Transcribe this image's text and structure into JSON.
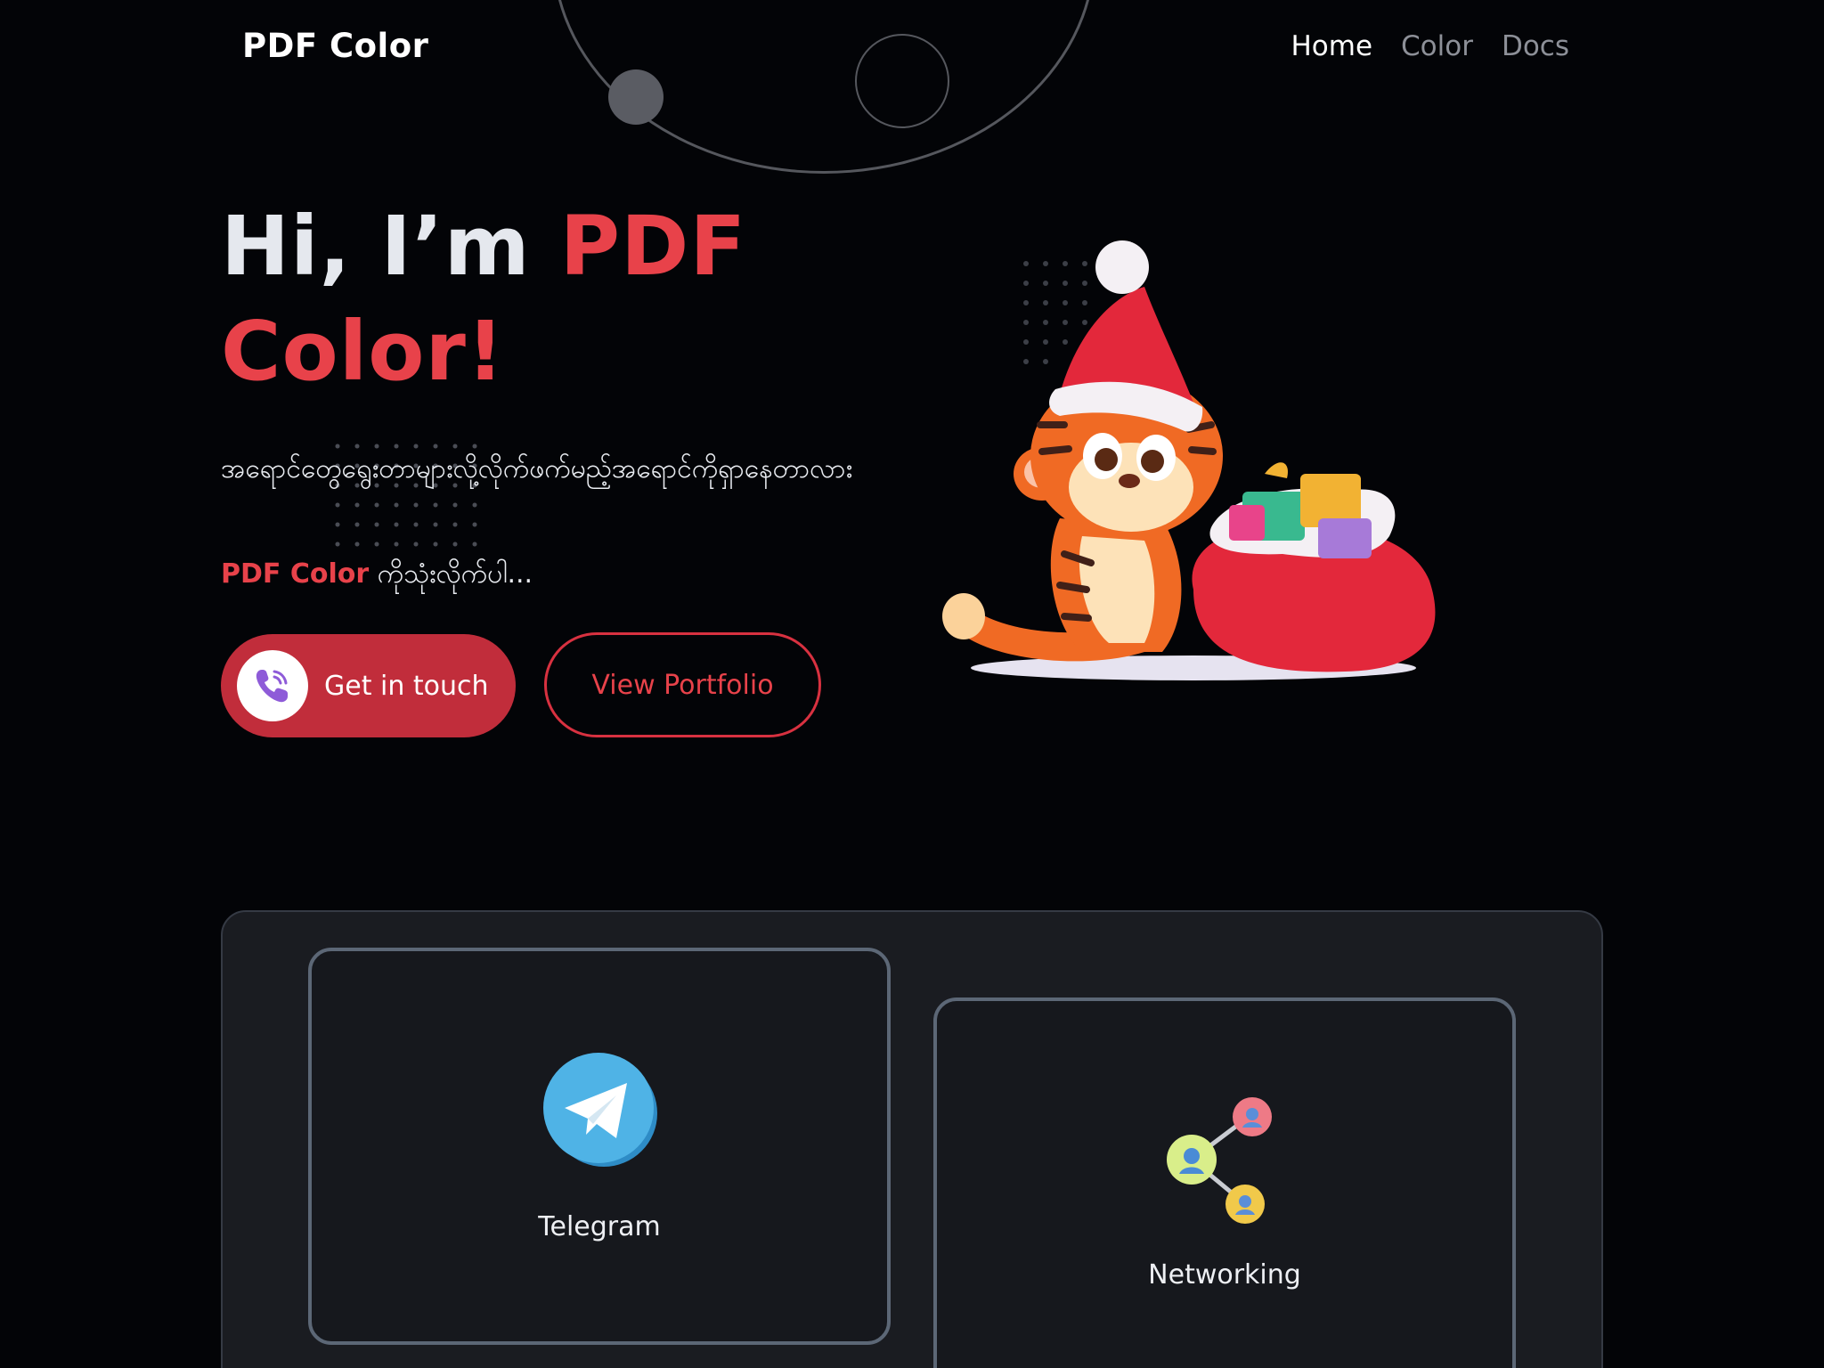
{
  "header": {
    "brand": "PDF Color",
    "nav": [
      {
        "label": "Home",
        "active": true
      },
      {
        "label": "Color",
        "active": false
      },
      {
        "label": "Docs",
        "active": false
      }
    ]
  },
  "hero": {
    "title_prefix": "Hi, I’m ",
    "title_accent": "PDF Color!",
    "description": "အရောင်တွေရွေးတာများလို့လိုက်ဖက်မည့်အရောင်ကိုရှာနေတာလား",
    "tagline_brand": "PDF Color",
    "tagline_rest": " ကိုသုံးလိုက်ပါ...",
    "cta_primary": "Get in touch",
    "cta_secondary": "View Portfolio"
  },
  "services": [
    {
      "label": "Telegram",
      "icon": "telegram-icon"
    },
    {
      "label": "Networking",
      "icon": "networking-icon"
    }
  ],
  "colors": {
    "background": "#030407",
    "accent": "#e8424a",
    "button": "#c12d3b",
    "panel": "#1a1c21",
    "card_border": "#5c6776"
  }
}
